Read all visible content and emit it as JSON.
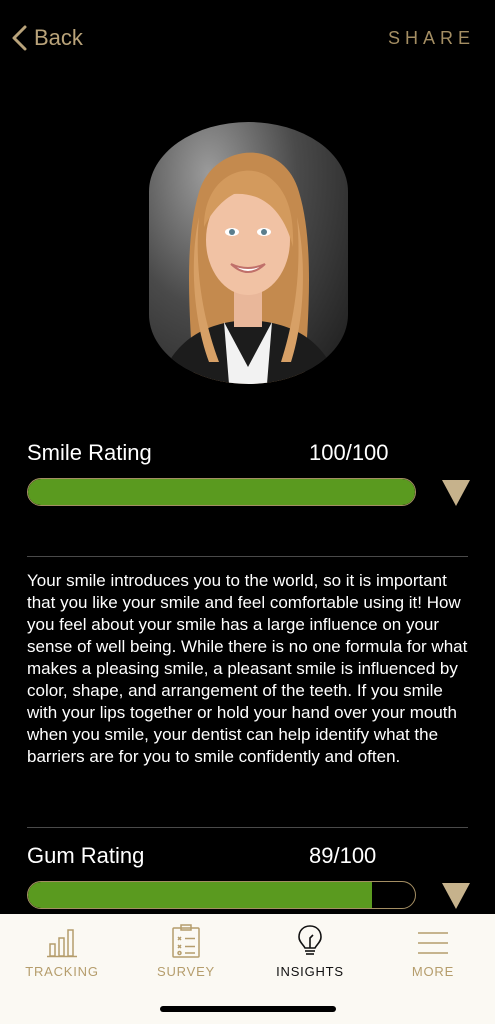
{
  "header": {
    "back_label": "Back",
    "share_label": "SHARE"
  },
  "ratings": [
    {
      "label": "Smile Rating",
      "score": "100/100",
      "percent": 100
    },
    {
      "label": "Gum Rating",
      "score": "89/100",
      "percent": 89
    }
  ],
  "description": "Your smile introduces you to the world, so it is important that you like your smile and feel comfortable using it! How you feel about your smile has a large influence on your sense of well being. While there is no one formula for what makes a pleasing smile, a pleasant smile is influenced by color, shape, and arrangement of the teeth. If you smile with your lips together or hold your hand over your mouth when you smile, your dentist can help identify what the barriers are for you to smile confidently and often.",
  "tabs": [
    {
      "label": "TRACKING",
      "icon": "bar-chart-icon"
    },
    {
      "label": "SURVEY",
      "icon": "clipboard-icon"
    },
    {
      "label": "INSIGHTS",
      "icon": "lightbulb-icon",
      "active": true
    },
    {
      "label": "MORE",
      "icon": "menu-icon"
    }
  ],
  "colors": {
    "accent": "#a48e63",
    "bar_fill": "#5a9a1f",
    "tab_bg": "#fbf9f3"
  }
}
